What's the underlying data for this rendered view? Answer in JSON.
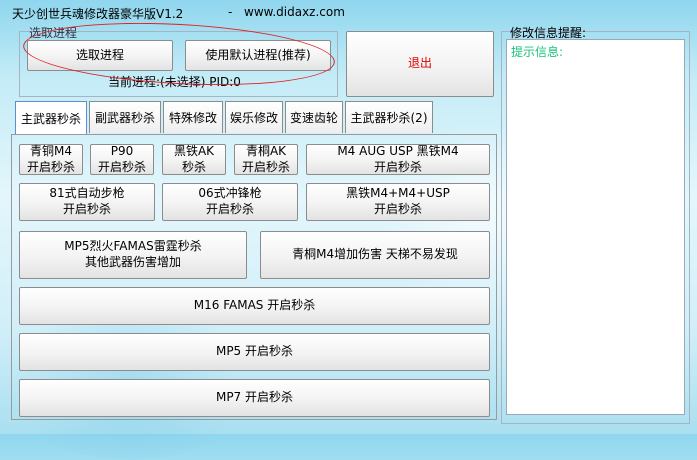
{
  "window": {
    "title": "天少创世兵魂修改器豪华版V1.2",
    "dash": "-",
    "url": "www.didaxz.com"
  },
  "process": {
    "group_label": "选取进程",
    "select_button": "选取进程",
    "default_button": "使用默认进程(推荐)",
    "current_label": "当前进程:(未选择)    PID:0"
  },
  "exit_button": "退出",
  "tabs": [
    {
      "label": "主武器秒杀",
      "active": true
    },
    {
      "label": "副武器秒杀"
    },
    {
      "label": "特殊修改"
    },
    {
      "label": "娱乐修改"
    },
    {
      "label": "变速齿轮"
    },
    {
      "label": "主武器秒杀(2)"
    }
  ],
  "weapons": [
    {
      "line1": "青铜M4",
      "line2": "开启秒杀"
    },
    {
      "line1": "P90",
      "line2": "开启秒杀"
    },
    {
      "line1": "黑铁AK",
      "line2": "秒杀"
    },
    {
      "line1": "青桐AK",
      "line2": "开启秒杀"
    },
    {
      "line1": "M4 AUG USP 黑铁M4",
      "line2": "开启秒杀"
    },
    {
      "line1": "81式自动步枪",
      "line2": "开启秒杀"
    },
    {
      "line1": "06式冲锋枪",
      "line2": "开启秒杀"
    },
    {
      "line1": "黑铁M4+M4+USP",
      "line2": "开启秒杀"
    },
    {
      "line1": "MP5烈火FAMAS雷霆秒杀",
      "line2": "其他武器伤害增加"
    },
    {
      "line1": "青桐M4增加伤害 天梯不易发现"
    },
    {
      "line1": "M16 FAMAS 开启秒杀"
    },
    {
      "line1": "MP5 开启秒杀"
    },
    {
      "line1": "MP7 开启秒杀"
    }
  ],
  "info": {
    "group_label": "修改信息提醒:",
    "hint": "提示信息:"
  },
  "colors": {
    "exit_text": "#e00000",
    "hint_text": "#19c37a",
    "annotation_oval": "#e02020"
  }
}
